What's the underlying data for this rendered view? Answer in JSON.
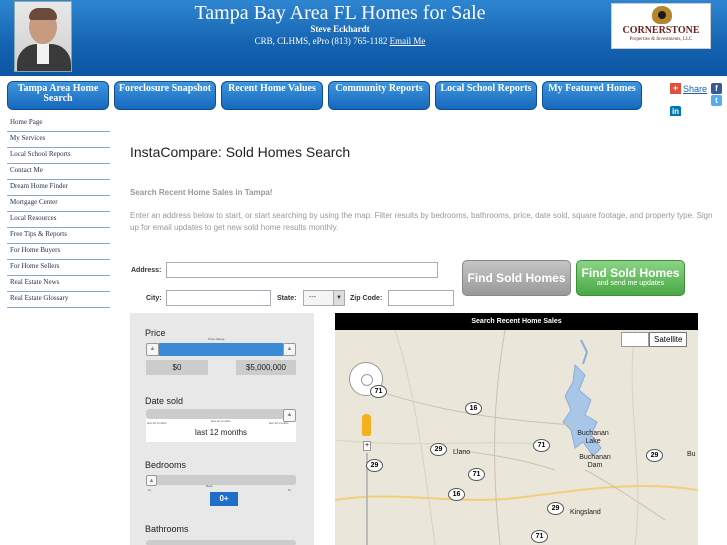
{
  "header": {
    "title": "Tampa Bay Area FL Homes for Sale",
    "agent_name": "Steve Eckhardt",
    "contact_prefix": "CRB, CLHMS, ePro (813) 765-1182",
    "email_link": "Email Me",
    "logo_name": "CORNERSTONE",
    "logo_sub": "Properties & Investments, LLC",
    "colors": {
      "banner": "#1462b1",
      "nav_button": "#1d6fc2"
    }
  },
  "nav": [
    {
      "label": "Tampa Area Home Search"
    },
    {
      "label": "Foreclosure Snapshot"
    },
    {
      "label": "Recent Home Values"
    },
    {
      "label": "Community Reports"
    },
    {
      "label": "Local School Reports"
    },
    {
      "label": "My Featured Homes"
    }
  ],
  "share": {
    "label": "Share",
    "icons": [
      "facebook-icon",
      "twitter-icon",
      "linkedin-icon"
    ]
  },
  "sidebar": {
    "items": [
      {
        "label": "Home Page"
      },
      {
        "label": "My Services"
      },
      {
        "label": "Local School Reports"
      },
      {
        "label": "Contact Me"
      },
      {
        "label": "Dream Home Finder"
      },
      {
        "label": "Mortgage Center"
      },
      {
        "label": "Local Resources"
      },
      {
        "label": "Free Tips & Reports"
      },
      {
        "label": "For Home Buyers"
      },
      {
        "label": "For Home Sellers"
      },
      {
        "label": "Real Estate News"
      },
      {
        "label": "Real Estate Glossary"
      }
    ]
  },
  "main": {
    "title": "InstaCompare: Sold Homes Search",
    "subheading": "Search Recent Home Sales in Tampa!",
    "description": "Enter an address below to start, or start searching by using the map. Filter results by bedrooms, bathrooms, price, date sold, square footage, and property type. Sign up for email updates to get new sold home results monthly."
  },
  "form": {
    "address_label": "Address:",
    "address_value": "",
    "city_label": "City:",
    "city_value": "",
    "state_label": "State:",
    "state_selected": "---",
    "zip_label": "Zip Code:",
    "zip_value": "",
    "find_button": "Find Sold Homes",
    "find_email_button": "Find Sold Homes",
    "find_email_sub": "and send me updates"
  },
  "filters": {
    "price": {
      "label": "Price",
      "range_caption": "Price Range",
      "min": "$0",
      "max": "$5,000,000",
      "fill_start": 0,
      "fill_end": 1
    },
    "date_sold": {
      "label": "Date sold",
      "value": "last 12 months",
      "caption_left": "last 12 months",
      "caption_mid": "last 12 months",
      "caption_right": "last 12 months"
    },
    "bedrooms": {
      "label": "Bedrooms",
      "caption": "Beds",
      "caption_left": "0+",
      "caption_right": "5+",
      "value": "0+"
    },
    "bathrooms": {
      "label": "Bathrooms"
    }
  },
  "map": {
    "header": "Search Recent Home Sales",
    "satellite_label": "Satellite",
    "highways": [
      "71",
      "16",
      "29",
      "29",
      "71",
      "71",
      "16",
      "29",
      "29",
      "71"
    ],
    "places": [
      "Llano",
      "Buchanan Lake",
      "Buchanan Dam",
      "Kingsland",
      "Bu"
    ]
  }
}
